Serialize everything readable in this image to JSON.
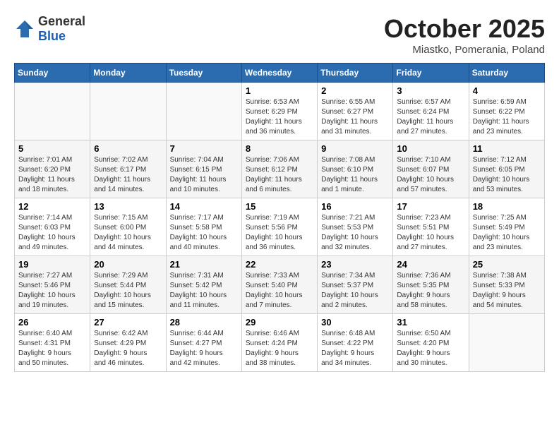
{
  "logo": {
    "general": "General",
    "blue": "Blue"
  },
  "header": {
    "month": "October 2025",
    "location": "Miastko, Pomerania, Poland"
  },
  "weekdays": [
    "Sunday",
    "Monday",
    "Tuesday",
    "Wednesday",
    "Thursday",
    "Friday",
    "Saturday"
  ],
  "weeks": [
    [
      {
        "day": "",
        "info": ""
      },
      {
        "day": "",
        "info": ""
      },
      {
        "day": "",
        "info": ""
      },
      {
        "day": "1",
        "info": "Sunrise: 6:53 AM\nSunset: 6:29 PM\nDaylight: 11 hours\nand 36 minutes."
      },
      {
        "day": "2",
        "info": "Sunrise: 6:55 AM\nSunset: 6:27 PM\nDaylight: 11 hours\nand 31 minutes."
      },
      {
        "day": "3",
        "info": "Sunrise: 6:57 AM\nSunset: 6:24 PM\nDaylight: 11 hours\nand 27 minutes."
      },
      {
        "day": "4",
        "info": "Sunrise: 6:59 AM\nSunset: 6:22 PM\nDaylight: 11 hours\nand 23 minutes."
      }
    ],
    [
      {
        "day": "5",
        "info": "Sunrise: 7:01 AM\nSunset: 6:20 PM\nDaylight: 11 hours\nand 18 minutes."
      },
      {
        "day": "6",
        "info": "Sunrise: 7:02 AM\nSunset: 6:17 PM\nDaylight: 11 hours\nand 14 minutes."
      },
      {
        "day": "7",
        "info": "Sunrise: 7:04 AM\nSunset: 6:15 PM\nDaylight: 11 hours\nand 10 minutes."
      },
      {
        "day": "8",
        "info": "Sunrise: 7:06 AM\nSunset: 6:12 PM\nDaylight: 11 hours\nand 6 minutes."
      },
      {
        "day": "9",
        "info": "Sunrise: 7:08 AM\nSunset: 6:10 PM\nDaylight: 11 hours\nand 1 minute."
      },
      {
        "day": "10",
        "info": "Sunrise: 7:10 AM\nSunset: 6:07 PM\nDaylight: 10 hours\nand 57 minutes."
      },
      {
        "day": "11",
        "info": "Sunrise: 7:12 AM\nSunset: 6:05 PM\nDaylight: 10 hours\nand 53 minutes."
      }
    ],
    [
      {
        "day": "12",
        "info": "Sunrise: 7:14 AM\nSunset: 6:03 PM\nDaylight: 10 hours\nand 49 minutes."
      },
      {
        "day": "13",
        "info": "Sunrise: 7:15 AM\nSunset: 6:00 PM\nDaylight: 10 hours\nand 44 minutes."
      },
      {
        "day": "14",
        "info": "Sunrise: 7:17 AM\nSunset: 5:58 PM\nDaylight: 10 hours\nand 40 minutes."
      },
      {
        "day": "15",
        "info": "Sunrise: 7:19 AM\nSunset: 5:56 PM\nDaylight: 10 hours\nand 36 minutes."
      },
      {
        "day": "16",
        "info": "Sunrise: 7:21 AM\nSunset: 5:53 PM\nDaylight: 10 hours\nand 32 minutes."
      },
      {
        "day": "17",
        "info": "Sunrise: 7:23 AM\nSunset: 5:51 PM\nDaylight: 10 hours\nand 27 minutes."
      },
      {
        "day": "18",
        "info": "Sunrise: 7:25 AM\nSunset: 5:49 PM\nDaylight: 10 hours\nand 23 minutes."
      }
    ],
    [
      {
        "day": "19",
        "info": "Sunrise: 7:27 AM\nSunset: 5:46 PM\nDaylight: 10 hours\nand 19 minutes."
      },
      {
        "day": "20",
        "info": "Sunrise: 7:29 AM\nSunset: 5:44 PM\nDaylight: 10 hours\nand 15 minutes."
      },
      {
        "day": "21",
        "info": "Sunrise: 7:31 AM\nSunset: 5:42 PM\nDaylight: 10 hours\nand 11 minutes."
      },
      {
        "day": "22",
        "info": "Sunrise: 7:33 AM\nSunset: 5:40 PM\nDaylight: 10 hours\nand 7 minutes."
      },
      {
        "day": "23",
        "info": "Sunrise: 7:34 AM\nSunset: 5:37 PM\nDaylight: 10 hours\nand 2 minutes."
      },
      {
        "day": "24",
        "info": "Sunrise: 7:36 AM\nSunset: 5:35 PM\nDaylight: 9 hours\nand 58 minutes."
      },
      {
        "day": "25",
        "info": "Sunrise: 7:38 AM\nSunset: 5:33 PM\nDaylight: 9 hours\nand 54 minutes."
      }
    ],
    [
      {
        "day": "26",
        "info": "Sunrise: 6:40 AM\nSunset: 4:31 PM\nDaylight: 9 hours\nand 50 minutes."
      },
      {
        "day": "27",
        "info": "Sunrise: 6:42 AM\nSunset: 4:29 PM\nDaylight: 9 hours\nand 46 minutes."
      },
      {
        "day": "28",
        "info": "Sunrise: 6:44 AM\nSunset: 4:27 PM\nDaylight: 9 hours\nand 42 minutes."
      },
      {
        "day": "29",
        "info": "Sunrise: 6:46 AM\nSunset: 4:24 PM\nDaylight: 9 hours\nand 38 minutes."
      },
      {
        "day": "30",
        "info": "Sunrise: 6:48 AM\nSunset: 4:22 PM\nDaylight: 9 hours\nand 34 minutes."
      },
      {
        "day": "31",
        "info": "Sunrise: 6:50 AM\nSunset: 4:20 PM\nDaylight: 9 hours\nand 30 minutes."
      },
      {
        "day": "",
        "info": ""
      }
    ]
  ]
}
